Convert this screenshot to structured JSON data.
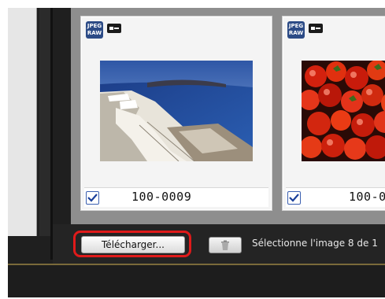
{
  "thumbnails": [
    {
      "badge_top": "JPEG",
      "badge_bottom": "RAW",
      "file_name": "100-0009",
      "checked": true
    },
    {
      "badge_top": "JPEG",
      "badge_bottom": "RAW",
      "file_name": "100-0",
      "checked": true
    }
  ],
  "toolbar": {
    "download_label": "Télécharger...",
    "status": "Sélectionne l'image 8 de 1"
  },
  "icons": {
    "badge": "jpeg-raw-badge-icon",
    "protect": "protect-lock-icon",
    "check": "checkmark-icon",
    "trash": "trash-icon"
  },
  "colors": {
    "highlight": "#e01a1a",
    "grid_background": "#8e8e8e",
    "checkbox": "#3a5fb0"
  }
}
